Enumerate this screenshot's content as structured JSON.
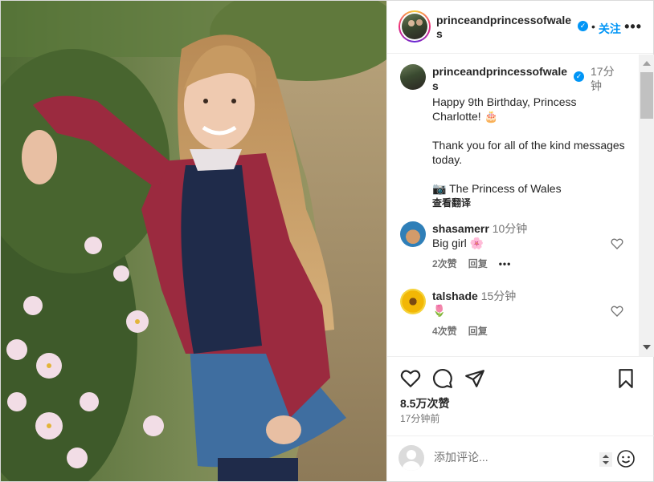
{
  "post": {
    "author": {
      "username": "princeandprincessofwales",
      "verified_icon": "verified-badge-icon",
      "follow_label": "关注",
      "separator": "•",
      "more_label": "•••"
    },
    "caption": {
      "username": "princeandprincessofwales",
      "time": "17分钟",
      "line1": "Happy 9th Birthday, Princess Charlotte! 🎂",
      "line2": "Thank you for all of the kind messages today.",
      "line3": "📷 The Princess of Wales",
      "translate": "查看翻译"
    },
    "comments": [
      {
        "username": "shasamerr",
        "time": "10分钟",
        "text": "Big girl 🌸",
        "likes": "2次赞",
        "reply": "回复",
        "more": "•••"
      },
      {
        "username": "talshade",
        "time": "15分钟",
        "text": "🌷",
        "likes": "4次赞",
        "reply": "回复"
      }
    ],
    "likes_count": "8.5万次赞",
    "posted_ago": "17分钟前",
    "comment_box": {
      "placeholder": "添加评论..."
    }
  },
  "colors": {
    "accent": "#0095f6",
    "muted": "#737373",
    "border": "#dbdbdb"
  }
}
